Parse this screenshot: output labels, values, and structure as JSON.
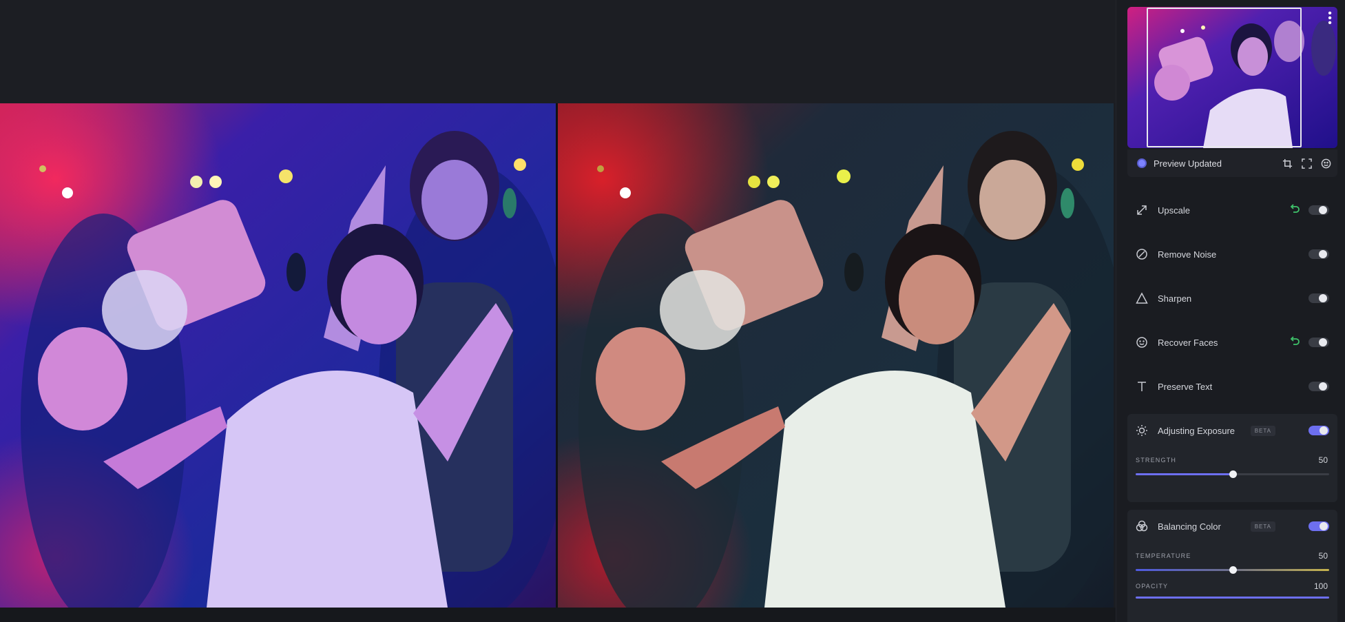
{
  "navigator": {
    "preview_label": "Preview Updated",
    "icons": [
      "crop-icon",
      "fullscreen-icon",
      "compare-icon"
    ],
    "more_icon": "more-vertical-icon"
  },
  "features": [
    {
      "name": "upscale",
      "label": "Upscale",
      "icon": "upscale-arrows-icon",
      "has_reset": true,
      "enabled": false
    },
    {
      "name": "remove-noise",
      "label": "Remove Noise",
      "icon": "remove-noise-icon",
      "has_reset": false,
      "enabled": false
    },
    {
      "name": "sharpen",
      "label": "Sharpen",
      "icon": "sharpen-triangle-icon",
      "has_reset": false,
      "enabled": false
    },
    {
      "name": "recover-faces",
      "label": "Recover Faces",
      "icon": "face-icon",
      "has_reset": true,
      "enabled": false
    },
    {
      "name": "preserve-text",
      "label": "Preserve Text",
      "icon": "text-icon",
      "has_reset": false,
      "enabled": false
    }
  ],
  "exposure": {
    "label": "Adjusting Exposure",
    "badge": "BETA",
    "enabled": true,
    "strength_label": "STRENGTH",
    "strength_value": "50",
    "strength_fraction": 0.5
  },
  "color": {
    "label": "Balancing Color",
    "badge": "BETA",
    "enabled": true,
    "temperature_label": "TEMPERATURE",
    "temperature_value": "50",
    "temperature_fraction": 0.5,
    "opacity_label": "OPACITY",
    "opacity_value": "100",
    "opacity_fraction": 1.0
  },
  "colors": {
    "accent": "#6d6ff0",
    "reset_green": "#3fc46b",
    "panel_bg": "#1a1c21"
  }
}
